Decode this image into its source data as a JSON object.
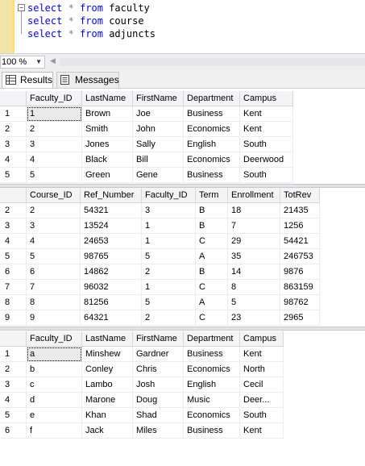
{
  "editor": {
    "fold_symbol": "−",
    "lines": [
      {
        "kw": "select",
        "op": "*",
        "kw2": "from",
        "table": "faculty"
      },
      {
        "kw": "select",
        "op": "*",
        "kw2": "from",
        "table": "course"
      },
      {
        "kw": "select",
        "op": "*",
        "kw2": "from",
        "table": "adjuncts"
      }
    ]
  },
  "zoom": {
    "value": "100 %"
  },
  "tabs": [
    {
      "label": "Results",
      "icon": "grid-icon",
      "active": true
    },
    {
      "label": "Messages",
      "icon": "messages-icon",
      "active": false
    }
  ],
  "faculty": {
    "columns": [
      "Faculty_ID",
      "LastName",
      "FirstName",
      "Department",
      "Campus"
    ],
    "rows": [
      [
        "1",
        "1",
        "Brown",
        "Joe",
        "Business",
        "Kent"
      ],
      [
        "2",
        "2",
        "Smith",
        "John",
        "Economics",
        "Kent"
      ],
      [
        "3",
        "3",
        "Jones",
        "Sally",
        "English",
        "South"
      ],
      [
        "4",
        "4",
        "Black",
        "Bill",
        "Economics",
        "Deerwood"
      ],
      [
        "5",
        "5",
        "Green",
        "Gene",
        "Business",
        "South"
      ]
    ]
  },
  "course": {
    "columns": [
      "Course_ID",
      "Ref_Number",
      "Faculty_ID",
      "Term",
      "Enrollment",
      "TotRev"
    ],
    "rows": [
      [
        "2",
        "2",
        "54321",
        "3",
        "B",
        "18",
        "21435"
      ],
      [
        "3",
        "3",
        "13524",
        "1",
        "B",
        "7",
        "1256"
      ],
      [
        "4",
        "4",
        "24653",
        "1",
        "C",
        "29",
        "54421"
      ],
      [
        "5",
        "5",
        "98765",
        "5",
        "A",
        "35",
        "246753"
      ],
      [
        "6",
        "6",
        "14862",
        "2",
        "B",
        "14",
        "9876"
      ],
      [
        "7",
        "7",
        "96032",
        "1",
        "C",
        "8",
        "863159"
      ],
      [
        "8",
        "8",
        "81256",
        "5",
        "A",
        "5",
        "98762"
      ],
      [
        "9",
        "9",
        "64321",
        "2",
        "C",
        "23",
        "2965"
      ]
    ]
  },
  "adjuncts": {
    "columns": [
      "Faculty_ID",
      "LastName",
      "FirstName",
      "Department",
      "Campus"
    ],
    "rows": [
      [
        "1",
        "a",
        "Minshew",
        "Gardner",
        "Business",
        "Kent"
      ],
      [
        "2",
        "b",
        "Conley",
        "Chris",
        "Economics",
        "North"
      ],
      [
        "3",
        "c",
        "Lambo",
        "Josh",
        "English",
        "Cecil"
      ],
      [
        "4",
        "d",
        "Marone",
        "Doug",
        "Music",
        "Deer..."
      ],
      [
        "5",
        "e",
        "Khan",
        "Shad",
        "Economics",
        "South"
      ],
      [
        "6",
        "f",
        "Jack",
        "Miles",
        "Business",
        "Kent"
      ]
    ]
  }
}
